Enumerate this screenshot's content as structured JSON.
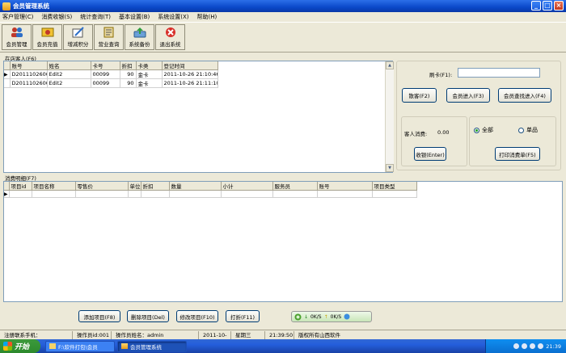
{
  "window": {
    "title": "会员管理系统"
  },
  "menu": [
    "客户管理(C)",
    "消费收银(S)",
    "统计查询(T)",
    "基本设置(B)",
    "系统设置(X)",
    "帮助(H)"
  ],
  "toolbar": [
    {
      "label": "会员管理",
      "icon": "members-icon"
    },
    {
      "label": "会员充值",
      "icon": "recharge-icon"
    },
    {
      "label": "增减积分",
      "icon": "points-icon"
    },
    {
      "label": "营业查询",
      "icon": "query-icon"
    },
    {
      "label": "系统备份",
      "icon": "backup-icon"
    },
    {
      "label": "退出系统",
      "icon": "exit-icon"
    }
  ],
  "guests": {
    "section_label": "在店客人(F6)",
    "columns": [
      "账号",
      "姓名",
      "卡号",
      "折扣",
      "卡类",
      "登记时间"
    ],
    "rows": [
      [
        "D201110260025",
        "Edit2",
        "00099",
        "90",
        "金卡",
        "2011-10-26 21:10:46"
      ],
      [
        "D201110260026",
        "Edit2",
        "00099",
        "90",
        "金卡",
        "2011-10-26 21:11:10"
      ]
    ]
  },
  "right_panel": {
    "card_label": "刷卡(F1):",
    "card_value": "",
    "btn_guest": "散客(F2)",
    "btn_member_enter": "会员进入(F3)",
    "btn_member_find": "会员查找进入(F4)",
    "consume_label": "客人消费:",
    "consume_value": "0.00",
    "radio_all": "全部",
    "radio_single": "单品",
    "btn_checkout": "收银(Enter)",
    "btn_print": "打印消费单(F5)"
  },
  "details": {
    "section_label": "消费明细(F7)",
    "columns": [
      "项目id",
      "项目名称",
      "零售价",
      "单位",
      "折扣",
      "数量",
      "小计",
      "服务员",
      "账号",
      "项目类型"
    ]
  },
  "actions": {
    "add": "添加项目(F8)",
    "delete": "删除项目(Del)",
    "modify": "修改项目(F10)",
    "discount": "打折(F11)"
  },
  "netspeed": {
    "down": "0K/S",
    "up": "0K/S"
  },
  "status": {
    "phone": "注册联系手机：13643637932",
    "operator_id": "操作员id:001",
    "operator_name": "操作员姓名：admin",
    "date": "2011-10-26",
    "weekday": "星期三",
    "time": "21:39:50",
    "copyright": "版权所有山西软件"
  },
  "taskbar": {
    "start": "开始",
    "tasks": [
      "F:\\软件打包\\会员",
      "会员管理系统"
    ],
    "clock": "21:39"
  }
}
